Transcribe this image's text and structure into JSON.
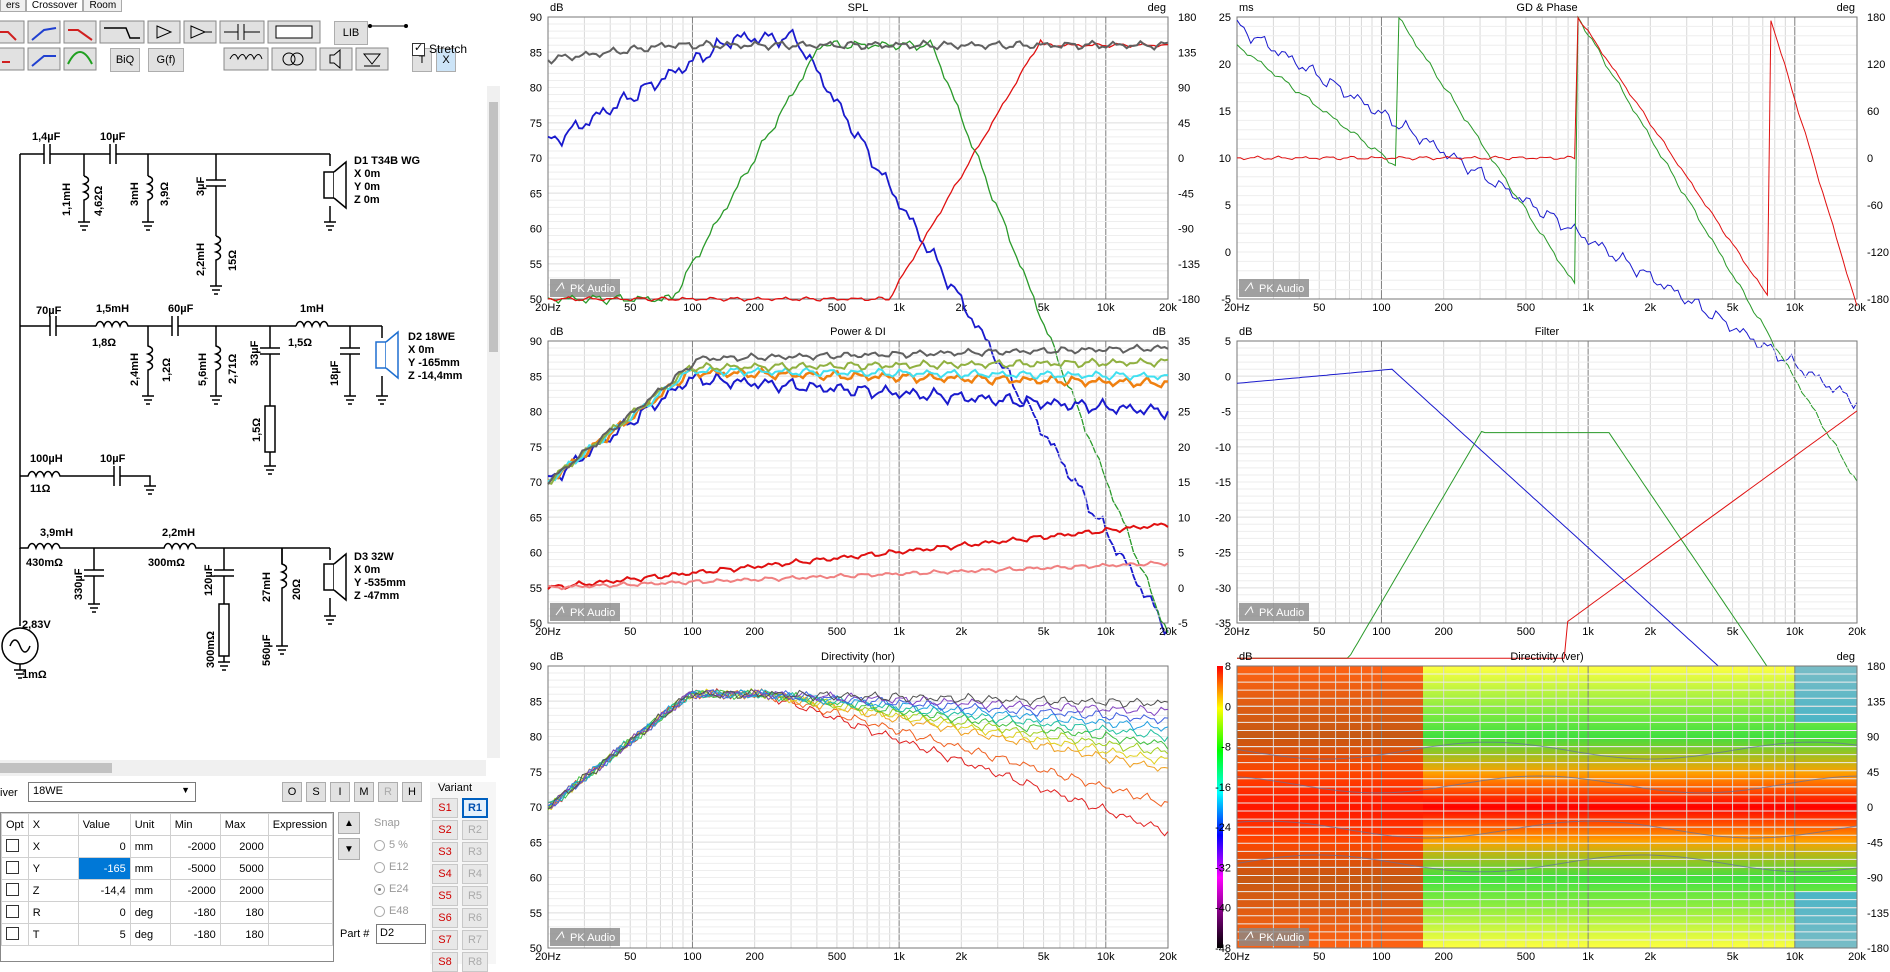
{
  "tabs": [
    "ers",
    "Crossover",
    "Room"
  ],
  "toolbar": {
    "lib": "LIB",
    "biq": "BiQ",
    "gf": "G(f)",
    "t": "T",
    "x": "X",
    "stretch": "Stretch"
  },
  "schematic": {
    "d1": {
      "name": "D1 T34B WG",
      "x": "X 0m",
      "y": "Y 0m",
      "z": "Z 0m"
    },
    "d2": {
      "name": "D2 18WE",
      "x": "X 0m",
      "y": "Y -165mm",
      "z": "Z -14,4mm"
    },
    "d3": {
      "name": "D3 32W",
      "x": "X 0m",
      "y": "Y -535mm",
      "z": "Z -47mm"
    },
    "top": {
      "c1": "1,4µF",
      "c2": "10µF",
      "l1": "1,1mH",
      "r1": "4,62Ω",
      "l2": "3mH",
      "r2": "3,9Ω",
      "c3": "3µF",
      "l3": "2,2mH",
      "r3": "15Ω"
    },
    "mid": {
      "c1": "70µF",
      "l1": "1,5mH",
      "r1": "1,8Ω",
      "c2": "60µF",
      "l2": "2,4mH",
      "r2": "1,2Ω",
      "l3": "5,6mH",
      "r3": "2,71Ω",
      "c3": "33µF",
      "r4": "1,5Ω",
      "l4": "1mH",
      "r5": "1,5Ω",
      "c4": "18µF"
    },
    "notch": {
      "l": "100µH",
      "r": "11Ω",
      "c": "10µF"
    },
    "low": {
      "l1": "3,9mH",
      "r1": "430mΩ",
      "c1": "330µF",
      "l2": "2,2mH",
      "r2": "300mΩ",
      "c2": "120µF",
      "r3": "300mΩ",
      "l3": "27mH",
      "r4": "20Ω",
      "c3": "560µF"
    },
    "source": {
      "v": "2,83V",
      "r": "1mΩ"
    }
  },
  "driver": {
    "label": "iver",
    "selected": "18WE",
    "buttons": [
      "O",
      "S",
      "I",
      "M",
      "R",
      "H"
    ]
  },
  "param_table": {
    "headers": [
      "Opt",
      "X",
      "Value",
      "Unit",
      "Min",
      "Max",
      "Expression"
    ],
    "rows": [
      {
        "name": "X",
        "value": "0",
        "unit": "mm",
        "min": "-2000",
        "max": "2000"
      },
      {
        "name": "Y",
        "value": "-165",
        "unit": "mm",
        "min": "-5000",
        "max": "5000"
      },
      {
        "name": "Z",
        "value": "-14,4",
        "unit": "mm",
        "min": "-2000",
        "max": "2000"
      },
      {
        "name": "R",
        "value": "0",
        "unit": "deg",
        "min": "-180",
        "max": "180"
      },
      {
        "name": "T",
        "value": "5",
        "unit": "deg",
        "min": "-180",
        "max": "180"
      }
    ]
  },
  "snap": {
    "label": "Snap",
    "options": [
      "5 %",
      "E12",
      "E24",
      "E48"
    ]
  },
  "part": {
    "label": "Part #",
    "value": "D2"
  },
  "variant": {
    "label": "Variant",
    "s": [
      "S1",
      "S2",
      "S3",
      "S4",
      "S5",
      "S6",
      "S7",
      "S8"
    ],
    "r": [
      "R1",
      "R2",
      "R3",
      "R4",
      "R5",
      "R6",
      "R7",
      "R8"
    ]
  },
  "watermark": "PK Audio",
  "freq_ticks": [
    "20Hz",
    "50",
    "100",
    "200",
    "500",
    "1k",
    "2k",
    "5k",
    "10k",
    "20k"
  ],
  "colors": {
    "blue": "#1a1acd",
    "green": "#2a9a2a",
    "red": "#e01010",
    "grey": "#606060",
    "cyan": "#40e0f0",
    "orange": "#f08010"
  },
  "charts": [
    {
      "title": "SPL",
      "left_unit": "dB",
      "right_unit": "deg",
      "left_ticks": [
        "90",
        "85",
        "80",
        "75",
        "70",
        "65",
        "60",
        "55",
        "50"
      ],
      "right_ticks": [
        "180",
        "135",
        "90",
        "45",
        "0",
        "-45",
        "-90",
        "-135",
        "-180"
      ]
    },
    {
      "title": "GD & Phase",
      "left_unit": "ms",
      "right_unit": "deg",
      "left_ticks": [
        "25",
        "20",
        "15",
        "10",
        "5",
        "0",
        "-5"
      ],
      "right_ticks": [
        "180",
        "120",
        "60",
        "0",
        "-60",
        "-120",
        "-180"
      ]
    },
    {
      "title": "Power & DI",
      "left_unit": "dB",
      "right_unit": "dB",
      "left_ticks": [
        "90",
        "85",
        "80",
        "75",
        "70",
        "65",
        "60",
        "55",
        "50"
      ],
      "right_ticks": [
        "35",
        "30",
        "25",
        "20",
        "15",
        "10",
        "5",
        "0",
        "-5"
      ]
    },
    {
      "title": "Filter",
      "left_unit": "dB",
      "right_unit": "",
      "left_ticks": [
        "5",
        "0",
        "-5",
        "-10",
        "-15",
        "-20",
        "-25",
        "-30",
        "-35"
      ],
      "right_ticks": []
    },
    {
      "title": "Directivity (hor)",
      "left_unit": "dB",
      "right_unit": "",
      "left_ticks": [
        "90",
        "85",
        "80",
        "75",
        "70",
        "65",
        "60",
        "55",
        "50"
      ],
      "right_ticks": []
    },
    {
      "title": "Directivity (ver)",
      "left_unit": "dB",
      "right_unit": "deg",
      "left_ticks": [
        "8",
        "0",
        "-8",
        "-16",
        "-24",
        "-32",
        "-40",
        "-48"
      ],
      "right_ticks": [
        "180",
        "135",
        "90",
        "45",
        "0",
        "-45",
        "-90",
        "-135",
        "-180"
      ]
    }
  ]
}
